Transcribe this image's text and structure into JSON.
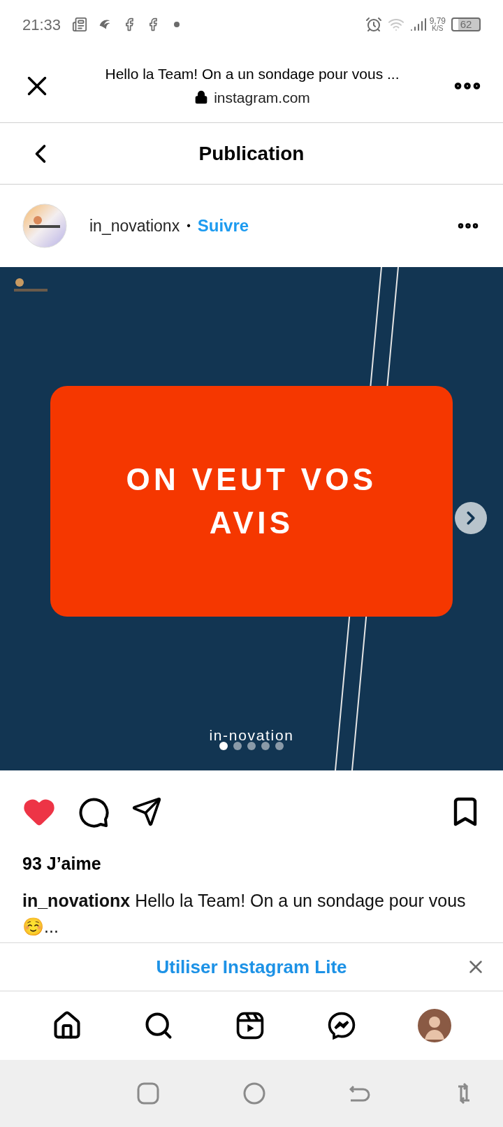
{
  "status_bar": {
    "time": "21:33",
    "speed": "9,79",
    "speed_unit": "K/S",
    "battery": "62"
  },
  "browser_bar": {
    "title": "Hello la Team! On a un sondage pour vous ...",
    "url": "instagram.com"
  },
  "page_header": {
    "title": "Publication"
  },
  "post": {
    "username": "in_novationx",
    "separator": "•",
    "follow": "Suivre",
    "slide": {
      "headline": "ON VEUT VOS AVIS",
      "brand": "in-novation"
    },
    "carousel_dots": [
      {
        "selected": true
      },
      {
        "selected": false
      },
      {
        "selected": false
      },
      {
        "selected": false
      },
      {
        "selected": false
      }
    ],
    "liked": true,
    "saved": false,
    "likes": "93 J’aime",
    "caption": {
      "username": "in_novationx",
      "text": "Hello la Team! On a un sondage pour vous ☺️..."
    }
  },
  "app_banner": {
    "label": "Utiliser Instagram Lite"
  },
  "bottom_nav": [
    {
      "kind": "home"
    },
    {
      "kind": "search"
    },
    {
      "kind": "reels"
    },
    {
      "kind": "messenger"
    },
    {
      "kind": "profile"
    }
  ]
}
